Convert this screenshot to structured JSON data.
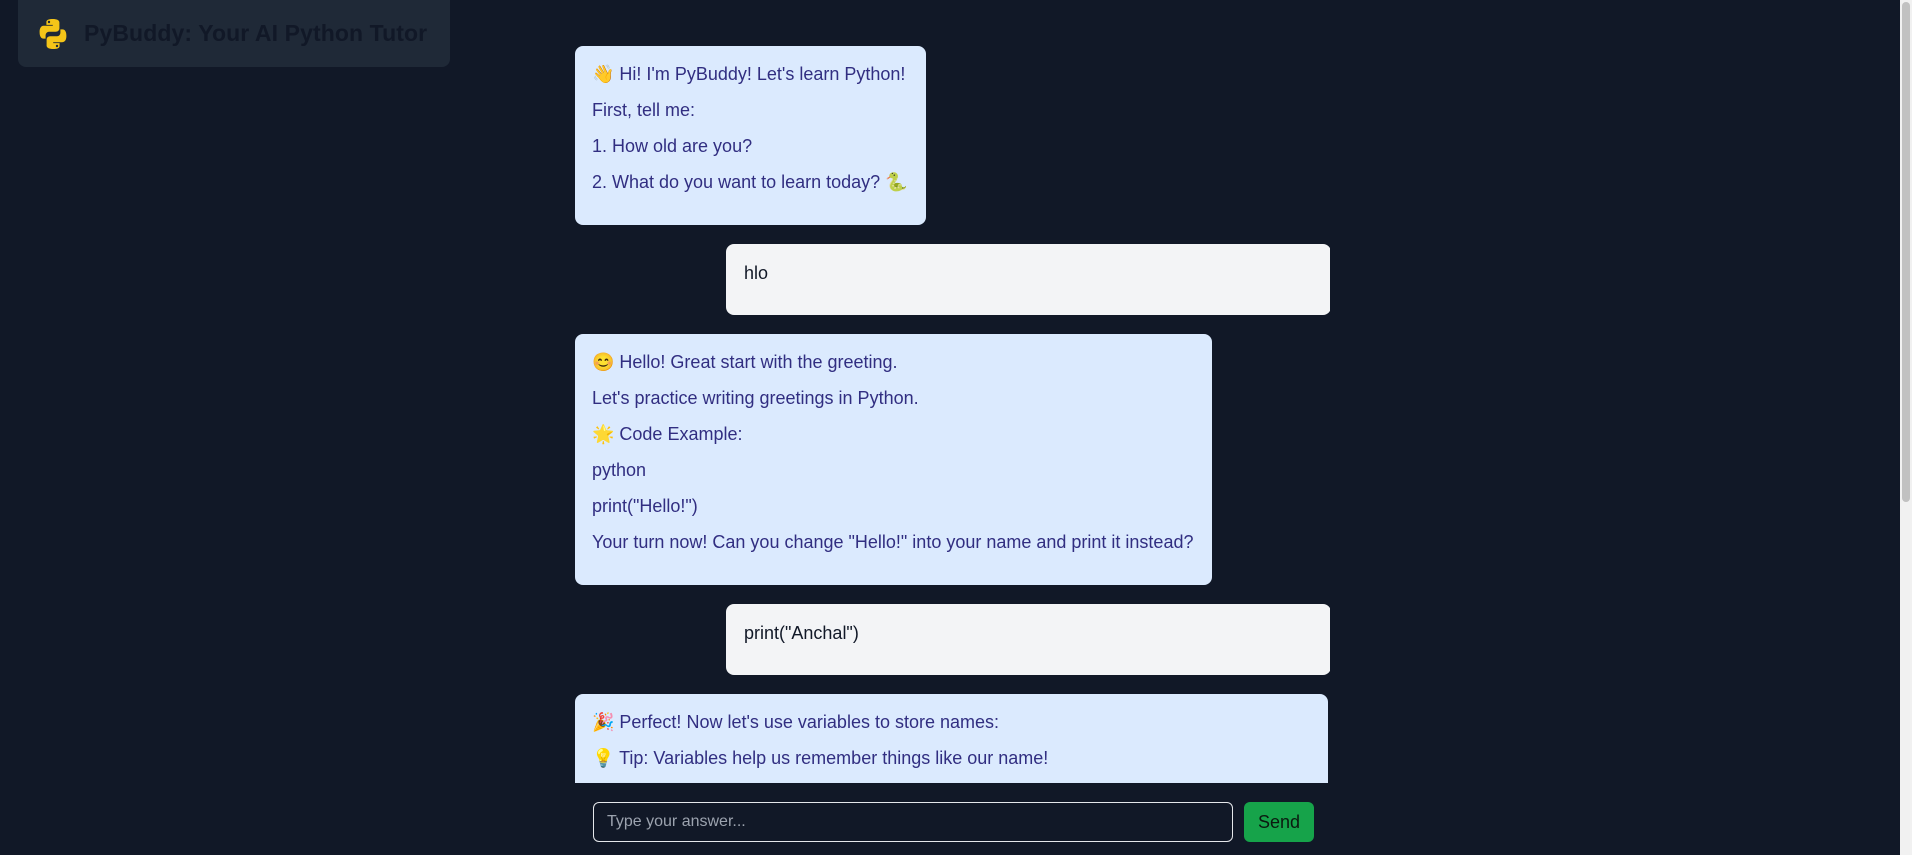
{
  "header": {
    "logo_icon": "python-logo-icon",
    "title": "PyBuddy: Your AI Python Tutor"
  },
  "messages": [
    {
      "role": "bot",
      "lines": [
        "👋 Hi! I'm PyBuddy! Let's learn Python!",
        "First, tell me:",
        "1. How old are you?",
        "2. What do you want to learn today? 🐍"
      ]
    },
    {
      "role": "user",
      "lines": [
        "hlo"
      ]
    },
    {
      "role": "bot",
      "lines": [
        "😊 Hello! Great start with the greeting.",
        "Let's practice writing greetings in Python.",
        "🌟 Code Example:",
        "python",
        "print(\"Hello!\")",
        "Your turn now! Can you change \"Hello!\" into your name and print it instead?"
      ]
    },
    {
      "role": "user",
      "lines": [
        "print(\"Anchal\")"
      ]
    },
    {
      "role": "bot",
      "lines": [
        "🎉 Perfect! Now let's use variables to store names:",
        "💡 Tip: Variables help us remember things like our name!"
      ]
    }
  ],
  "composer": {
    "placeholder": "Type your answer...",
    "value": "",
    "send_label": "Send"
  },
  "colors": {
    "background": "#111827",
    "bot_bubble": "#dbeafe",
    "bot_text": "#312e81",
    "user_bubble": "#f3f4f6",
    "send_button": "#16a34a"
  }
}
